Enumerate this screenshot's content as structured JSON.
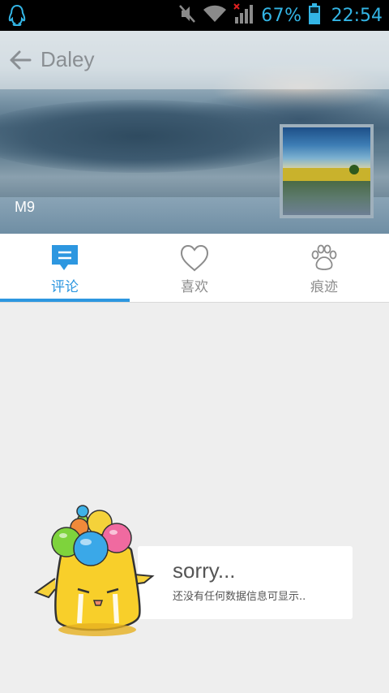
{
  "status_bar": {
    "battery_percent": "67%",
    "time": "22:54",
    "accent_color": "#33b5e5",
    "icons": [
      "qq-penguin-icon",
      "mute-icon",
      "wifi-icon",
      "signal-icon",
      "battery-icon"
    ]
  },
  "header": {
    "title": "Daley",
    "device": "M9"
  },
  "tabs": [
    {
      "label": "评论",
      "icon": "comment-icon",
      "active": true
    },
    {
      "label": "喜欢",
      "icon": "heart-icon",
      "active": false
    },
    {
      "label": "痕迹",
      "icon": "paw-icon",
      "active": false
    }
  ],
  "empty_state": {
    "title": "sorry...",
    "message": "还没有任何数据信息可显示.."
  },
  "colors": {
    "accent": "#2d97e0",
    "background": "#eeeeee"
  }
}
